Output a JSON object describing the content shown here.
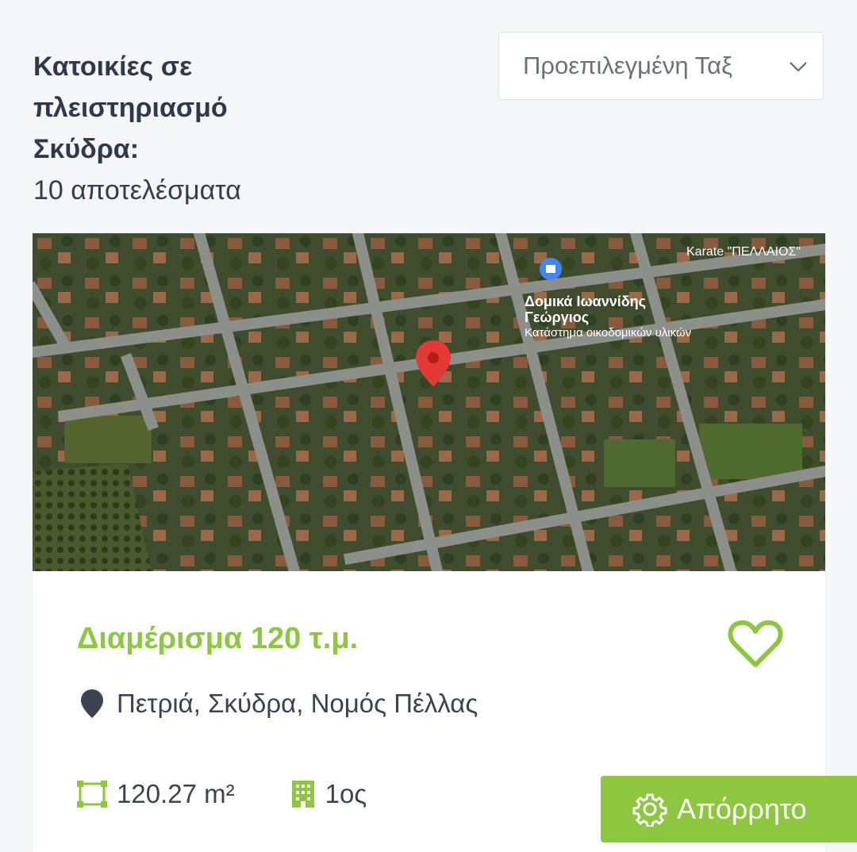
{
  "header": {
    "title": "Κατοικίες σε πλειστηριασμό Σκύδρα:",
    "result_count": "10 αποτελέσματα"
  },
  "sort": {
    "selected": "Προεπιλεγμένη Ταξ",
    "icon": "chevron-down-icon"
  },
  "listing": {
    "map": {
      "labels": {
        "karate": "Karate \"ΠΕΛΛΑΙΟΣ\"",
        "store_name_line1": "Δομικά Ιωαννίδης",
        "store_name_line2": "Γεώργιος",
        "store_category": "Κατάστημα οικοδομικών υλικών"
      }
    },
    "title": "Διαμέρισμα 120 τ.μ.",
    "location": "Πετριά, Σκύδρα, Νομός Πέλλας",
    "area": "120.27 m²",
    "floor": "1ος",
    "accent_color": "#8dc63f"
  },
  "privacy_button": {
    "label": "Απόρρητο",
    "icon": "gear-icon"
  }
}
